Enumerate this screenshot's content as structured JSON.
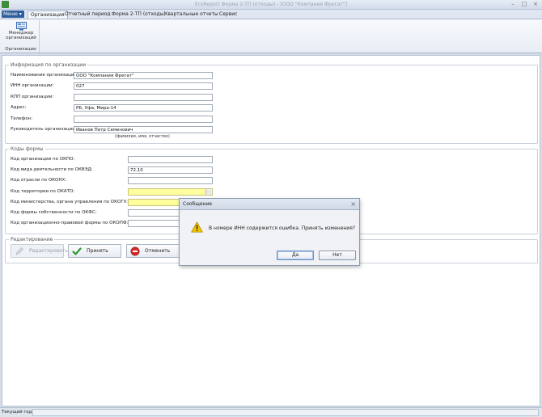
{
  "window": {
    "title": "EcoReport Форма 2-ТП (отходы) - [ООО \"Компания Фрегат\"]",
    "minimize_glyph": "–",
    "maximize_glyph": "□",
    "close_glyph": "×"
  },
  "menu_button": {
    "label": "Меню ▾"
  },
  "ribbon_tabs": [
    {
      "label": "Организация",
      "active": true
    },
    {
      "label": "Отчетный период",
      "active": false
    },
    {
      "label": "Форма 2-ТП (отходы)",
      "active": false
    },
    {
      "label": "Квартальные отчеты",
      "active": false
    },
    {
      "label": "Сервис",
      "active": false
    }
  ],
  "ribbon": {
    "button_label_line1": "Менеджер",
    "button_label_line2": "организаций",
    "group_label": "Организации",
    "button_icon": "organization-manager-icon"
  },
  "org_info": {
    "legend": "Информация по организации",
    "fields": [
      {
        "label": "Наименование организации:",
        "value": "ООО \"Компания Фрегат\""
      },
      {
        "label": "ИНН организации:",
        "value": "027"
      },
      {
        "label": "КПП организации:",
        "value": ""
      },
      {
        "label": "Адрес:",
        "value": "РБ, Уфа, Мира-14"
      },
      {
        "label": "Телефон:",
        "value": ""
      },
      {
        "label": "Руководитель организации:",
        "value": "Иванов Петр Семенович"
      }
    ],
    "hint": "(фамилия, имя, отчество)"
  },
  "codes": {
    "legend": "Коды формы",
    "fields": [
      {
        "label": "Код организации по ОКПО:",
        "value": ""
      },
      {
        "label": "Код вида деятельности по ОКВЭД:",
        "value": "72.10"
      },
      {
        "label": "Код отрасли по ОКОНХ:",
        "value": ""
      },
      {
        "label": "Код территории по ОКАТО:",
        "value": ""
      },
      {
        "label": "Код министерства, органа управления по ОКОГУ:",
        "value": ""
      },
      {
        "label": "Код формы собственности по ОКФС:",
        "value": ""
      },
      {
        "label": "Код организационно-правовой формы по ОКОПФ:",
        "value": ""
      }
    ],
    "dropdown_glyph": "…"
  },
  "editing": {
    "legend": "Редактирование",
    "edit_label": "Редактировать",
    "accept_label": "Принять",
    "cancel_label": "Отменить"
  },
  "status": {
    "label": "Текущий год:"
  },
  "dialog": {
    "title": "Сообщение",
    "close_glyph": "×",
    "message": "В номере ИНН содержится ошибка. Принять изменения?",
    "yes_label": "Да",
    "no_label": "Нет"
  },
  "colors": {
    "required_field": "#fefe9c",
    "menu_button": "#2f5e9c",
    "accept_check": "#2e9a2e",
    "cancel_stop": "#d42a2a",
    "warning": "#f2c200"
  }
}
